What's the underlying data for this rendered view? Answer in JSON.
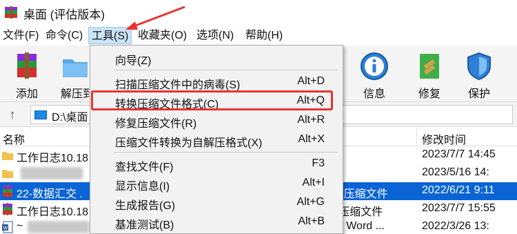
{
  "window": {
    "title": "桌面 (评估版本)"
  },
  "menubar": {
    "items": [
      "文件(F)",
      "命令(C)",
      "工具(S)",
      "收藏夹(O)",
      "选项(N)",
      "帮助(H)"
    ]
  },
  "toolbar": {
    "add": "添加",
    "extract": "解压到",
    "info": "信息",
    "repair": "修复",
    "protect": "保护"
  },
  "address": {
    "path": "D:\\桌面"
  },
  "filelist": {
    "col_name": "名称",
    "col_modified": "修改时间",
    "rows": [
      {
        "name": "工作日志10.18",
        "type": "",
        "date": "2023/7/7 14:45"
      },
      {
        "name": "",
        "type": "",
        "date": "2023/5/16 14:"
      },
      {
        "name": "22-数据汇交 .",
        "type": "AR 压缩文件",
        "date": "2022/6/21 9:11"
      },
      {
        "name": "工作日志10.18",
        "type": "IP 压缩文件",
        "date": "2023/7/7 15:55"
      },
      {
        "name": "~",
        "type": "soft Word ...",
        "date": "2022/3/26 13:"
      }
    ]
  },
  "tools_menu": {
    "items": [
      {
        "label": "向导(Z)",
        "shortcut": ""
      },
      {
        "label": "扫描压缩文件中的病毒(S)",
        "shortcut": "Alt+D"
      },
      {
        "label": "转换压缩文件格式(C)",
        "shortcut": "Alt+Q"
      },
      {
        "label": "修复压缩文件(R)",
        "shortcut": "Alt+R"
      },
      {
        "label": "压缩文件转换为自解压格式(X)",
        "shortcut": "Alt+X"
      },
      {
        "label": "查找文件(F)",
        "shortcut": "F3"
      },
      {
        "label": "显示信息(I)",
        "shortcut": "Alt+I"
      },
      {
        "label": "生成报告(G)",
        "shortcut": "Alt+G"
      },
      {
        "label": "基准测试(B)",
        "shortcut": "Alt+B"
      }
    ]
  },
  "colors": {
    "highlight": "#e8332f",
    "selection": "#0a64d6",
    "menu_active": "#cce4f7"
  }
}
